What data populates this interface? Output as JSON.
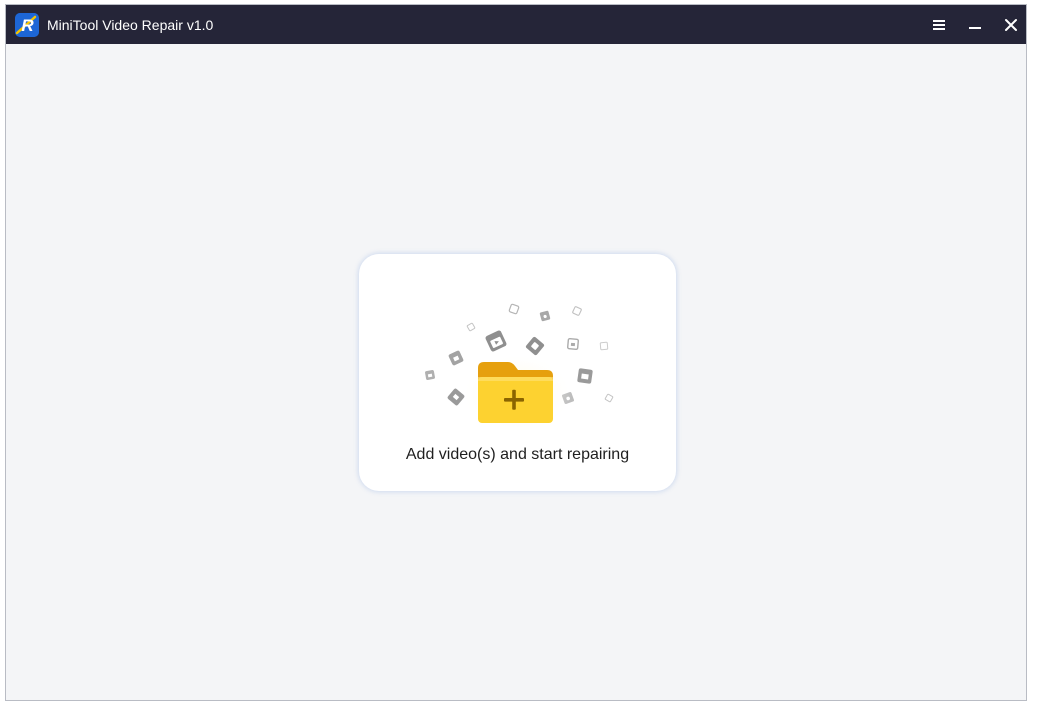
{
  "window": {
    "title": "MiniTool Video Repair v1.0",
    "logo_letter": "R"
  },
  "titlebar": {
    "icons": [
      "app-logo-icon",
      "hamburger-menu-icon",
      "minimize-icon",
      "close-icon"
    ]
  },
  "main": {
    "drop_label": "Add video(s) and start repairing",
    "illustration_icon": "folder-plus-icon"
  },
  "colors": {
    "titlebar_bg": "#252538",
    "content_bg": "#f4f5f7",
    "folder_front": "#fdd230",
    "folder_back": "#e9a20c",
    "plus": "#8a6400",
    "scattered_files": "#a3a3a3"
  }
}
